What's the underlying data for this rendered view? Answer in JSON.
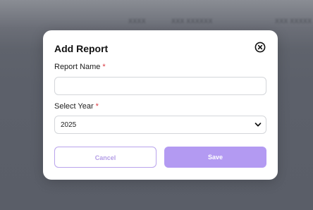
{
  "background": {
    "header_items": [
      "XXXX",
      "XXX XXXXXX",
      "XXX XXXXX"
    ]
  },
  "modal": {
    "title": "Add Report",
    "close_icon": "close-circle-icon",
    "report_name": {
      "label": "Report Name",
      "required_mark": "*",
      "value": "",
      "placeholder": ""
    },
    "year": {
      "label": "Select Year",
      "required_mark": "*",
      "selected": "2025",
      "icon": "chevron-down-icon"
    },
    "buttons": {
      "cancel": "Cancel",
      "save": "Save"
    }
  },
  "colors": {
    "accent": "#b39af2",
    "cancel_border": "#b9a3ec",
    "required": "#d9363e",
    "overlay": "#5c606a"
  }
}
